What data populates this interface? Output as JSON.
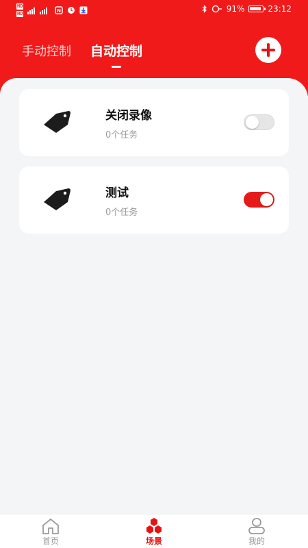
{
  "status_bar": {
    "sim1": "HD",
    "sim2": "HD",
    "signal_text": "4G",
    "battery": "91%",
    "time": "23:12"
  },
  "tabs": [
    {
      "label": "手动控制",
      "active": false
    },
    {
      "label": "自动控制",
      "active": true
    }
  ],
  "scenes": [
    {
      "title": "关闭录像",
      "subtitle": "0个任务",
      "enabled": false,
      "icon": "tag-icon"
    },
    {
      "title": "测试",
      "subtitle": "0个任务",
      "enabled": true,
      "icon": "tag-icon"
    }
  ],
  "bottom_nav": [
    {
      "label": "首页",
      "icon": "home-icon",
      "active": false
    },
    {
      "label": "场景",
      "icon": "scene-icon",
      "active": true
    },
    {
      "label": "我的",
      "icon": "profile-icon",
      "active": false
    }
  ],
  "colors": {
    "brand_red": "#f01a1a",
    "toggle_on": "#e71a1a",
    "toggle_off": "#e6e6e6",
    "background": "#f4f5f7"
  }
}
